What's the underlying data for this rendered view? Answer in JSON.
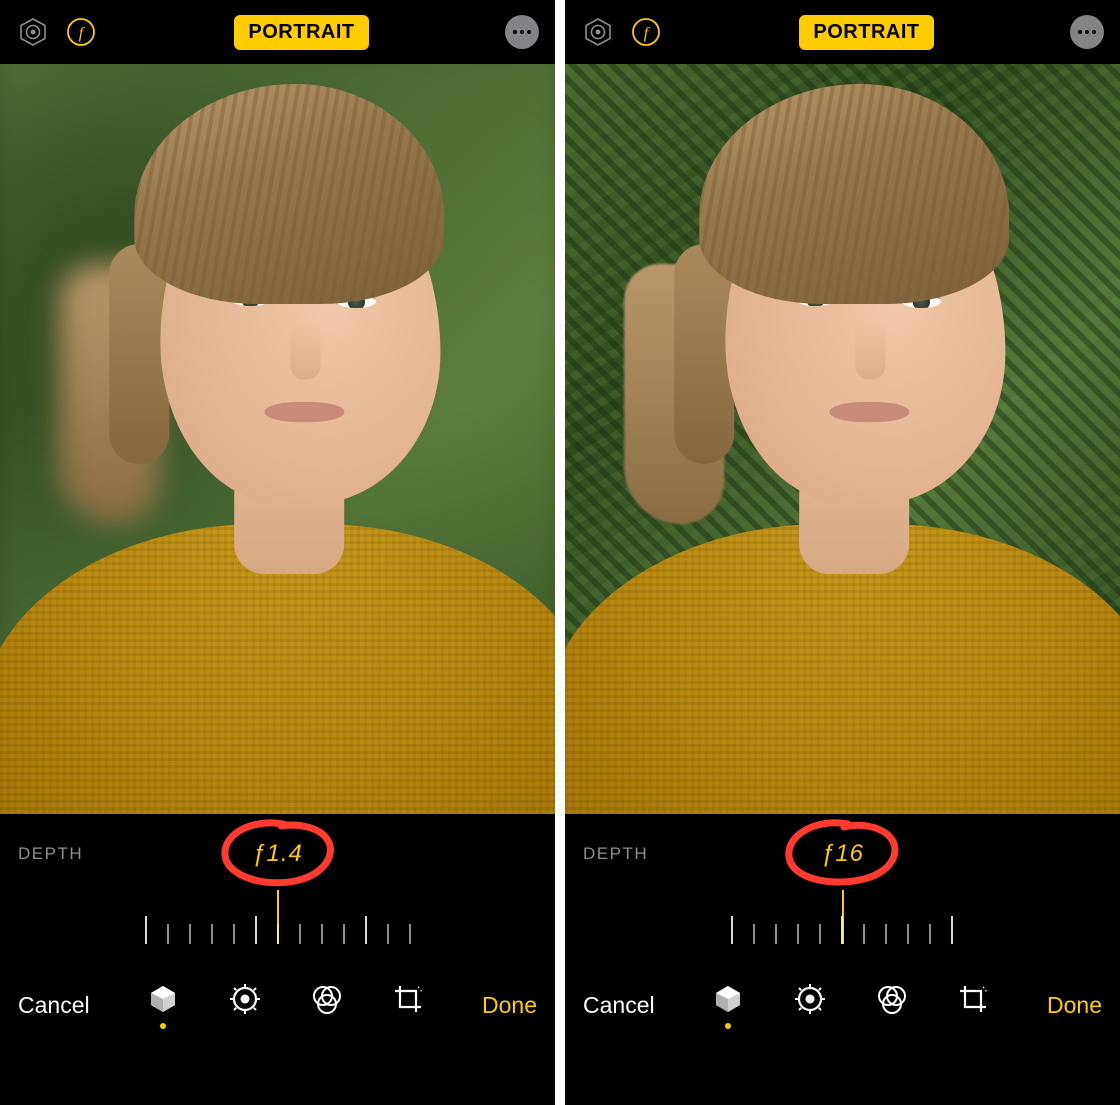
{
  "panes": [
    {
      "topbar": {
        "mode_badge": "PORTRAIT"
      },
      "depth": {
        "label": "DEPTH",
        "value": "ƒ1.4"
      },
      "bottom": {
        "cancel": "Cancel",
        "done": "Done"
      },
      "background_blur": true
    },
    {
      "topbar": {
        "mode_badge": "PORTRAIT"
      },
      "depth": {
        "label": "DEPTH",
        "value": "ƒ16"
      },
      "bottom": {
        "cancel": "Cancel",
        "done": "Done"
      },
      "background_blur": false
    }
  ],
  "colors": {
    "accent": "#ffcc00",
    "annotation": "#ff3b30"
  }
}
